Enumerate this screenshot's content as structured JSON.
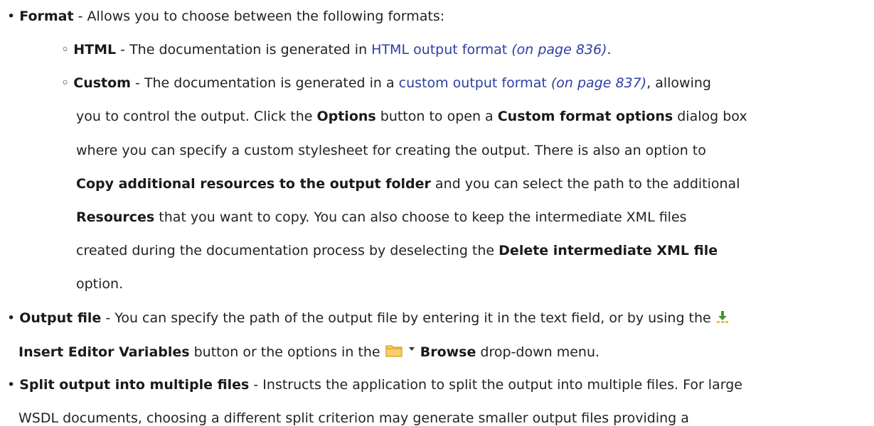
{
  "format_item": {
    "name": "Format",
    "desc": " - Allows you to choose between the following formats:",
    "options": [
      {
        "name": "HTML",
        "desc": " - The documentation is generated in ",
        "link": "HTML output format",
        "page_ref": "(on page 836)",
        "end": "."
      },
      {
        "name": "Custom",
        "desc": " - The documentation is generated in a ",
        "link": "custom output format",
        "page_ref": "(on page 837)",
        "tail": ", allowing",
        "l2": "you to control the output. Click the ",
        "options_btn": "Options",
        "l2b": " button to open a ",
        "cfo": "Custom format options",
        "l2c": " dialog box",
        "l3": "where you can specify a custom stylesheet for creating the output. There is also an option to",
        "copy_res": "Copy additional resources to the output folder",
        "l4": " and you can select the path to the additional",
        "resources": "Resources",
        "l5": " that you want to copy. You can also choose to keep the intermediate XML files",
        "l6": "created during the documentation process by deselecting the ",
        "delete_xml": "Delete intermediate XML file",
        "l7": "option."
      }
    ]
  },
  "output_item": {
    "name": "Output file",
    "desc": " - You can specify the path of the output file by entering it in the text field, or by using the ",
    "insert_label": "Insert Editor Variables",
    "l2": " button or the options in the ",
    "browse": "Browse",
    "l2b": " drop-down menu."
  },
  "split_item": {
    "name": "Split output into multiple files",
    "desc": " - Instructs the application to split the output into multiple files. For large",
    "l2": "WSDL documents, choosing a different split criterion may generate smaller output files providing a"
  },
  "icons": {
    "insert_variables": "insert-editor-variables-icon",
    "folder": "folder-icon",
    "dropdown": "dropdown-arrow-icon"
  },
  "colors": {
    "link": "#2b3fa3",
    "text": "#222222",
    "folder": "#f0b93a",
    "insert_arrow": "#3f9b2f"
  }
}
